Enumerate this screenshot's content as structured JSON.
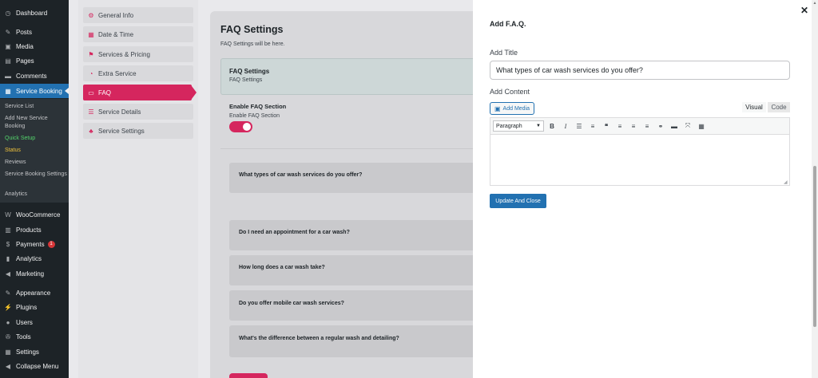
{
  "wp_menu": {
    "dashboard": "Dashboard",
    "posts": "Posts",
    "media": "Media",
    "pages": "Pages",
    "comments": "Comments",
    "service_booking": "Service Booking",
    "submenu": {
      "service_list": "Service List",
      "add_new": "Add New Service Booking",
      "quick_setup": "Quick Setup",
      "status": "Status",
      "reviews": "Reviews",
      "settings": "Service Booking Settings",
      "analytics": "Analytics"
    },
    "woocommerce": "WooCommerce",
    "products": "Products",
    "payments": "Payments",
    "payments_badge": "1",
    "analytics": "Analytics",
    "marketing": "Marketing",
    "appearance": "Appearance",
    "plugins": "Plugins",
    "users": "Users",
    "tools": "Tools",
    "settings": "Settings",
    "collapse": "Collapse Menu"
  },
  "settings_nav": [
    {
      "label": "General Info",
      "icon": "gear-icon"
    },
    {
      "label": "Date & Time",
      "icon": "calendar-icon"
    },
    {
      "label": "Services & Pricing",
      "icon": "tag-icon"
    },
    {
      "label": "Extra Service",
      "icon": "gauge-icon"
    },
    {
      "label": "FAQ",
      "icon": "chat-icon"
    },
    {
      "label": "Service Details",
      "icon": "list-icon"
    },
    {
      "label": "Service Settings",
      "icon": "sitemap-icon"
    }
  ],
  "faq_panel": {
    "title": "FAQ Settings",
    "subtitle": "FAQ Settings will be here.",
    "box_title": "FAQ Settings",
    "box_subtitle": "FAQ Settings",
    "enable_label": "Enable FAQ Section",
    "enable_sub": "Enable FAQ Section",
    "enable_on": true,
    "questions": [
      "What types of car wash services do you offer?",
      "Do I need an appointment for a car wash?",
      "How long does a car wash take?",
      "Do you offer mobile car wash services?",
      "What's the difference between a regular wash and detailing?"
    ]
  },
  "modal": {
    "title": "Add F.A.Q.",
    "add_title_label": "Add Title",
    "title_value": "What types of car wash services do you offer?",
    "add_content_label": "Add Content",
    "add_media": "Add Media",
    "tab_visual": "Visual",
    "tab_code": "Code",
    "format_value": "Paragraph",
    "update_button": "Update And Close"
  },
  "colors": {
    "accent_pink": "#d5265e",
    "wp_blue": "#2271b1",
    "sidebar_dark": "#1d2327"
  }
}
